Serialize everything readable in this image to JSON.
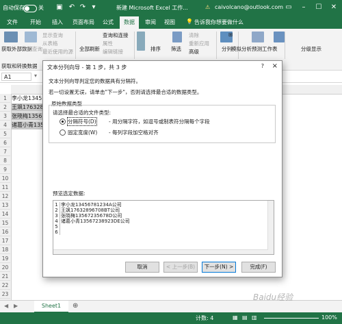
{
  "titlebar": {
    "autosave": "自动保存",
    "autosave_state": "关",
    "doc_title": "新建 Microsoft Excel 工作...",
    "account": "caivolcano@outlook.com",
    "warn_glyph": "⚠"
  },
  "tabs": [
    "文件",
    "开始",
    "插入",
    "页面布局",
    "公式",
    "数据",
    "审阅",
    "视图"
  ],
  "tell_me": "告诉我你想要做什么",
  "ribbon": {
    "get_data": "获取外部数据",
    "new_query": "新建查询",
    "show_queries": "显示查询",
    "from_table": "从表格",
    "recent_sources": "最近使用的源",
    "refresh_all": "全部刷新",
    "connections": "查询和连接",
    "properties": "属性",
    "edit_links": "编辑链接",
    "sort": "排序",
    "filter": "筛选",
    "clear": "清除",
    "reapply": "重新应用",
    "advanced": "高级",
    "text_to_columns": "分列",
    "whatif": "模拟分析",
    "forecast_sheet": "预测工作表",
    "outline": "分级显示",
    "group_label": "获取和转换数据"
  },
  "formula": {
    "namebox": "A1"
  },
  "grid": {
    "rows": [
      "1",
      "2",
      "3",
      "4",
      "5",
      "6",
      "7",
      "8",
      "9",
      "10",
      "11",
      "12",
      "13",
      "14",
      "15",
      "16",
      "17",
      "18",
      "19",
      "20",
      "21",
      "22",
      "23"
    ],
    "cells": [
      "李小龙13456",
      "王飒176328",
      "张晓梅13567",
      "诸葛小青135"
    ]
  },
  "sheet": {
    "tab": "Sheet1"
  },
  "status": {
    "count": "计数: 4",
    "zoom": "100%"
  },
  "dialog": {
    "title": "文本分列向导 - 第 1 步，共 3 步",
    "help": "?",
    "close": "×",
    "intro": "文本分列向导判定您的数据具有分隔符。",
    "hint": "若一切设置无误，请单击\"下一步\"，否则请选择最合适的数据类型。",
    "group_title": "原始数据类型",
    "choose": "请选择最合适的文件类型:",
    "opt_delim": "分隔符号(D)",
    "opt_delim_desc": "- 用分隔字符，如逗号或制表符分隔每个字段",
    "opt_fixed": "固定宽度(W)",
    "opt_fixed_desc": "- 每列字段加空格对齐",
    "preview_label": "预览选定数据:",
    "preview_lines": [
      "李小龙13456781234A公司",
      "王飒17632896708BT公司",
      "张晓梅13567235678D公司",
      "诸葛小青13567238923DE公司",
      "",
      ""
    ],
    "btn_cancel": "取消",
    "btn_prev": "< 上一步(B)",
    "btn_next": "下一步(N) >",
    "btn_finish": "完成(F)"
  },
  "watermark": "Baidu经验"
}
